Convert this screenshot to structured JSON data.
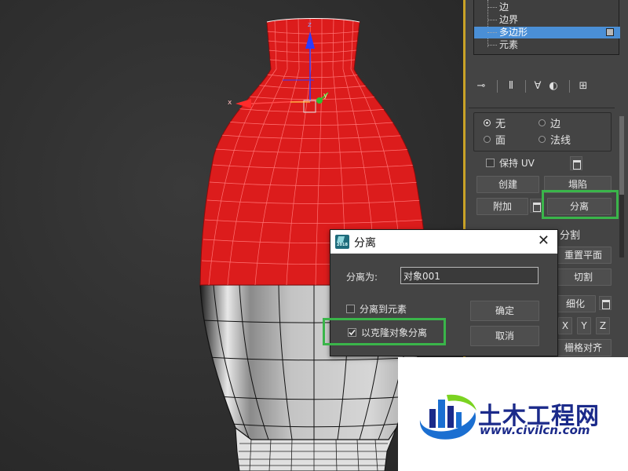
{
  "tree": {
    "items": [
      {
        "label": "边",
        "selected": false
      },
      {
        "label": "边界",
        "selected": false
      },
      {
        "label": "多边形",
        "selected": true
      },
      {
        "label": "元素",
        "selected": false
      }
    ]
  },
  "toolbar": {
    "icons": [
      "pin-icon",
      "pipe-icon",
      "funnel-icon",
      "vertex-icon",
      "configure-icon"
    ]
  },
  "selection": {
    "radios": [
      {
        "label": "无",
        "checked": true
      },
      {
        "label": "边",
        "checked": false
      },
      {
        "label": "面",
        "checked": false
      },
      {
        "label": "法线",
        "checked": false
      }
    ],
    "keep_uv_label": "保持 UV",
    "keep_uv_checked": false
  },
  "geometry": {
    "create_label": "创建",
    "collapse_label": "塌陷",
    "attach_label": "附加",
    "detach_label": "分离",
    "split_label": "分割",
    "reset_plane_label": "重置平面",
    "slice_label": "切割",
    "refine_label": "细化",
    "x_label": "X",
    "y_label": "Y",
    "z_label": "Z",
    "grid_align_label": "栅格对齐"
  },
  "dialog": {
    "title": "分离",
    "app_icon_text": "2018",
    "close_glyph": "✕",
    "detach_as_label": "分离为:",
    "detach_as_value": "对象001",
    "to_element_label": "分离到元素",
    "to_element_checked": false,
    "as_clone_label": "以克隆对象分离",
    "as_clone_checked": true,
    "ok_label": "确定",
    "cancel_label": "取消"
  },
  "watermark": {
    "name": "土木工程网",
    "url": "www.civilcn.com"
  },
  "colors": {
    "selection_red": "#dc1c1c",
    "highlight_green": "#3ab54a",
    "panel_border": "#c9a227",
    "tree_selected": "#4a8fd6",
    "watermark_blue": "#1b2a8a"
  }
}
